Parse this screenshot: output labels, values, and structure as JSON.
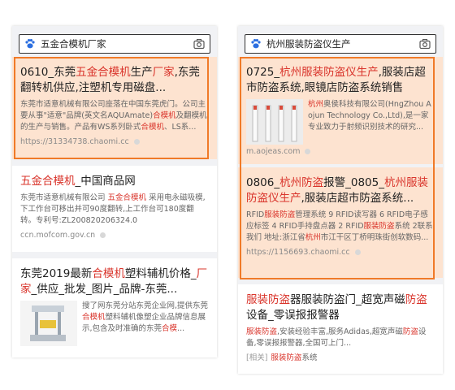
{
  "left": {
    "search": {
      "query": "五金合模机厂家"
    },
    "results": [
      {
        "title": [
          {
            "t": "0610_东莞",
            "hl": false
          },
          {
            "t": "五金合模机",
            "hl": true
          },
          {
            "t": "生产",
            "hl": false
          },
          {
            "t": "厂家",
            "hl": true
          },
          {
            "t": ",东莞翻转机供应,注塑机专用磁盘...",
            "hl": false
          }
        ],
        "abstract": [
          {
            "t": "东莞市适意机械有限公司座落在中国东莞虎门。公司主要从事\"适意\"品牌(英文名AQUAmate)",
            "hl": false
          },
          {
            "t": "合模机",
            "hl": true
          },
          {
            "t": "及翻模机的生产与销售。产品有WS系列卧式",
            "hl": false
          },
          {
            "t": "合模机",
            "hl": true
          },
          {
            "t": "、LS系...",
            "hl": false
          }
        ],
        "url": "https://31334738.chaomi.cc"
      },
      {
        "title": [
          {
            "t": "五金合模机",
            "hl": true
          },
          {
            "t": "_中国商品网",
            "hl": false
          }
        ],
        "abstract": [
          {
            "t": "东莞市适意机械有限公司 ",
            "hl": false
          },
          {
            "t": "五金合模机",
            "hl": true
          },
          {
            "t": " 采用电永磁吸模,下工作台可移出并可90度翻转,上工作台可180度翻转。专利号:ZL200820206324.0",
            "hl": false
          }
        ],
        "url": "ccn.mofcom.gov.cn"
      },
      {
        "title": [
          {
            "t": "东莞2019最新",
            "hl": false
          },
          {
            "t": "合模机",
            "hl": true
          },
          {
            "t": "塑料辅机价格_",
            "hl": false
          },
          {
            "t": "厂家",
            "hl": true
          },
          {
            "t": "_供应_批发_图片_品牌-东莞...",
            "hl": false
          }
        ],
        "abstract": [
          {
            "t": "搜了网东莞分站东莞企业网,提供东莞",
            "hl": false
          },
          {
            "t": "合模机",
            "hl": true
          },
          {
            "t": "塑料辅机像塑企业品牌信息展示,包含及时准确的东莞",
            "hl": false
          },
          {
            "t": "合模",
            "hl": true
          },
          {
            "t": "...",
            "hl": false
          }
        ]
      }
    ]
  },
  "right": {
    "search": {
      "query": "杭州服装防盗仪生产"
    },
    "results": [
      {
        "title": [
          {
            "t": "0725_",
            "hl": false
          },
          {
            "t": "杭州服装防盗仪生产",
            "hl": true
          },
          {
            "t": ",服装店超市防盗系统,眼镜店防盗系统销售",
            "hl": false
          }
        ],
        "abstract": [
          {
            "t": "杭州",
            "hl": true
          },
          {
            "t": "奥侯科技有限公司(HngZhou Aojun Technology Co.,Ltd),是一家专业致力于射频识别技术的研究...",
            "hl": false
          }
        ],
        "url": "m.aojeas.com"
      },
      {
        "title": [
          {
            "t": "0806_",
            "hl": false
          },
          {
            "t": "杭州防盗",
            "hl": true
          },
          {
            "t": "报警_0805_",
            "hl": false
          },
          {
            "t": "杭州服装防盗仪生产",
            "hl": true
          },
          {
            "t": ",服装店超市防盗系统...",
            "hl": false
          }
        ],
        "abstract": [
          {
            "t": "RFID",
            "hl": false
          },
          {
            "t": "服装防盗",
            "hl": true
          },
          {
            "t": "管理系统 9 RFID读写器 6 RFID电子感应标签 4 RFID手持盘点器 2 RFID",
            "hl": false
          },
          {
            "t": "服装防盗",
            "hl": true
          },
          {
            "t": "系统 2联系我们 地址:浙江省",
            "hl": false
          },
          {
            "t": "杭州",
            "hl": true
          },
          {
            "t": "市江干区丁桥明珠街创软数码...",
            "hl": false
          }
        ],
        "url": "https://1156693.chaomi.cc"
      },
      {
        "title": [
          {
            "t": "服装防盗",
            "hl": true
          },
          {
            "t": "器服装防盗门_超宽声磁",
            "hl": false
          },
          {
            "t": "防盗",
            "hl": true
          },
          {
            "t": "设备_零误报报警器",
            "hl": false
          }
        ],
        "abstract": [
          {
            "t": "服装防盗",
            "hl": true
          },
          {
            "t": ",安装经验丰富,服务Adidas,超宽声磁",
            "hl": false
          },
          {
            "t": "防盗",
            "hl": true
          },
          {
            "t": "设备,零误报报警器,全国可上门...",
            "hl": false
          }
        ],
        "related_tag": "[相关]",
        "related": [
          {
            "t": "服装防盗",
            "hl": true
          },
          {
            "t": "系统",
            "hl": false
          }
        ]
      }
    ]
  },
  "colors": {
    "highlight": "#d9342b",
    "accent_box": "#f07a28",
    "highlight_bg": "#fde3d0"
  },
  "icons": [
    "paw-search-icon",
    "camera-icon",
    "machine-thumbnail",
    "antitheft-gate-thumbnail"
  ]
}
